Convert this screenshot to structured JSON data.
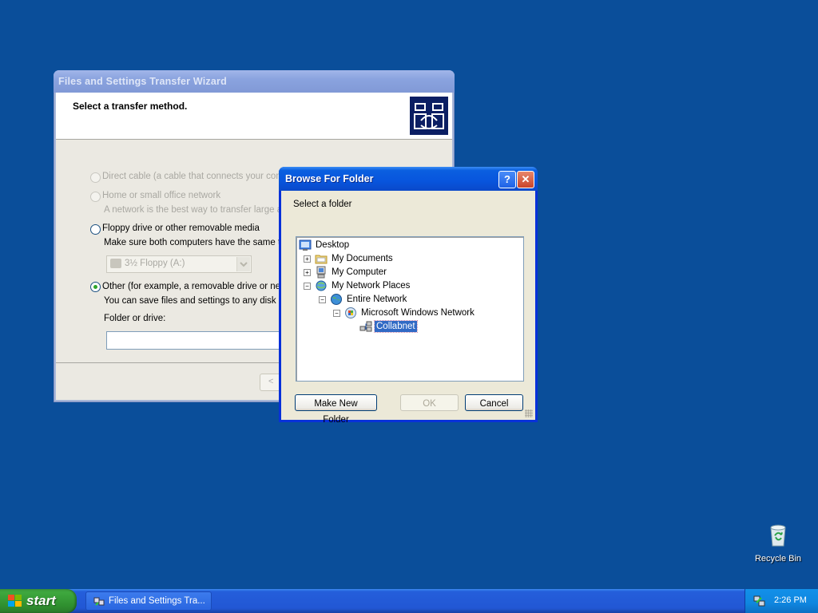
{
  "wizard": {
    "title": "Files and Settings Transfer Wizard",
    "heading": "Select a transfer method.",
    "options": [
      {
        "label": "Direct cable (a cable that connects your computers' serial ports)",
        "enabled": false,
        "selected": false
      },
      {
        "label": "Home or small office network",
        "desc": "A network is the best way to transfer large amo",
        "enabled": false,
        "selected": false
      },
      {
        "label": "Floppy drive or other removable media",
        "desc": "Make sure both computers have the same type",
        "enabled": true,
        "selected": false
      },
      {
        "label": "Other (for example, a removable drive or netwo",
        "desc": "You can save files and settings to any disk driv",
        "enabled": true,
        "selected": true
      }
    ],
    "floppy_combo_value": "3½ Floppy (A:)",
    "folder_label": "Folder or drive:",
    "folder_value": "",
    "back_label": "<"
  },
  "browse": {
    "title": "Browse For Folder",
    "help_label": "?",
    "close_label": "✕",
    "prompt": "Select a folder",
    "tree": [
      {
        "label": "Desktop",
        "icon": "desktop-icon",
        "expander": "",
        "selected": false
      },
      {
        "label": "My Documents",
        "icon": "folder-icon",
        "expander": "+",
        "selected": false
      },
      {
        "label": "My Computer",
        "icon": "computer-icon",
        "expander": "+",
        "selected": false
      },
      {
        "label": "My Network Places",
        "icon": "network-places-icon",
        "expander": "−",
        "selected": false
      },
      {
        "label": "Entire Network",
        "icon": "globe-icon",
        "expander": "−",
        "selected": false
      },
      {
        "label": "Microsoft Windows Network",
        "icon": "windows-network-icon",
        "expander": "−",
        "selected": false
      },
      {
        "label": "Collabnet",
        "icon": "workgroup-icon",
        "expander": "",
        "selected": true
      }
    ],
    "buttons": {
      "new_folder": "Make New Folder",
      "ok": "OK",
      "cancel": "Cancel"
    }
  },
  "desktop": {
    "recycle_bin": "Recycle Bin"
  },
  "taskbar": {
    "start_label": "start",
    "task_label": "Files and Settings Tra...",
    "clock": "2:26 PM"
  },
  "colors": {
    "desktop": "#0a4e9a",
    "selection": "#316ac5",
    "start_green": "#3ea83e"
  }
}
